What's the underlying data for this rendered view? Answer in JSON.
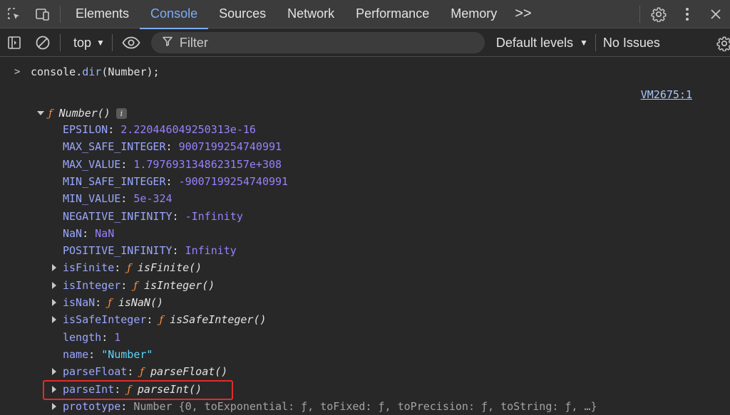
{
  "tabs": {
    "items": [
      "Elements",
      "Console",
      "Sources",
      "Network",
      "Performance",
      "Memory"
    ],
    "active": "Console",
    "more": ">>"
  },
  "toolbar": {
    "context": "top",
    "filter_placeholder": "Filter",
    "levels": "Default levels",
    "issues": "No Issues"
  },
  "console": {
    "input_prompt": ">",
    "input_obj": "console",
    "input_dot": ".",
    "input_fn": "dir",
    "input_args": "(Number);",
    "source": "VM2675:1",
    "root_f": "ƒ",
    "root_name": "Number()",
    "info_badge": "i",
    "properties": [
      {
        "key": "EPSILON",
        "value": "2.220446049250313e-16",
        "kind": "num"
      },
      {
        "key": "MAX_SAFE_INTEGER",
        "value": "9007199254740991",
        "kind": "num"
      },
      {
        "key": "MAX_VALUE",
        "value": "1.7976931348623157e+308",
        "kind": "num"
      },
      {
        "key": "MIN_SAFE_INTEGER",
        "value": "-9007199254740991",
        "kind": "num"
      },
      {
        "key": "MIN_VALUE",
        "value": "5e-324",
        "kind": "num"
      },
      {
        "key": "NEGATIVE_INFINITY",
        "value": "-Infinity",
        "kind": "num"
      },
      {
        "key": "NaN",
        "value": "NaN",
        "kind": "num"
      },
      {
        "key": "POSITIVE_INFINITY",
        "value": "Infinity",
        "kind": "num"
      },
      {
        "key": "isFinite",
        "value": "isFinite()",
        "kind": "fn"
      },
      {
        "key": "isInteger",
        "value": "isInteger()",
        "kind": "fn"
      },
      {
        "key": "isNaN",
        "value": "isNaN()",
        "kind": "fn"
      },
      {
        "key": "isSafeInteger",
        "value": "isSafeInteger()",
        "kind": "fn"
      },
      {
        "key": "length",
        "value": "1",
        "kind": "num"
      },
      {
        "key": "name",
        "value": "\"Number\"",
        "kind": "str"
      },
      {
        "key": "parseFloat",
        "value": "parseFloat()",
        "kind": "fn"
      },
      {
        "key": "parseInt",
        "value": "parseInt()",
        "kind": "fn"
      },
      {
        "key": "prototype",
        "value": "Number {0, toExponential: ƒ, toFixed: ƒ, toPrecision: ƒ, toString: ƒ, …}",
        "kind": "obj"
      }
    ]
  },
  "colors": {
    "accent": "#7cacf8",
    "highlight_border": "#e52a2a",
    "function_symbol": "#ff8a3d",
    "number": "#9980ff",
    "string": "#5cd5fb",
    "property_key": "#9aa7ff"
  }
}
